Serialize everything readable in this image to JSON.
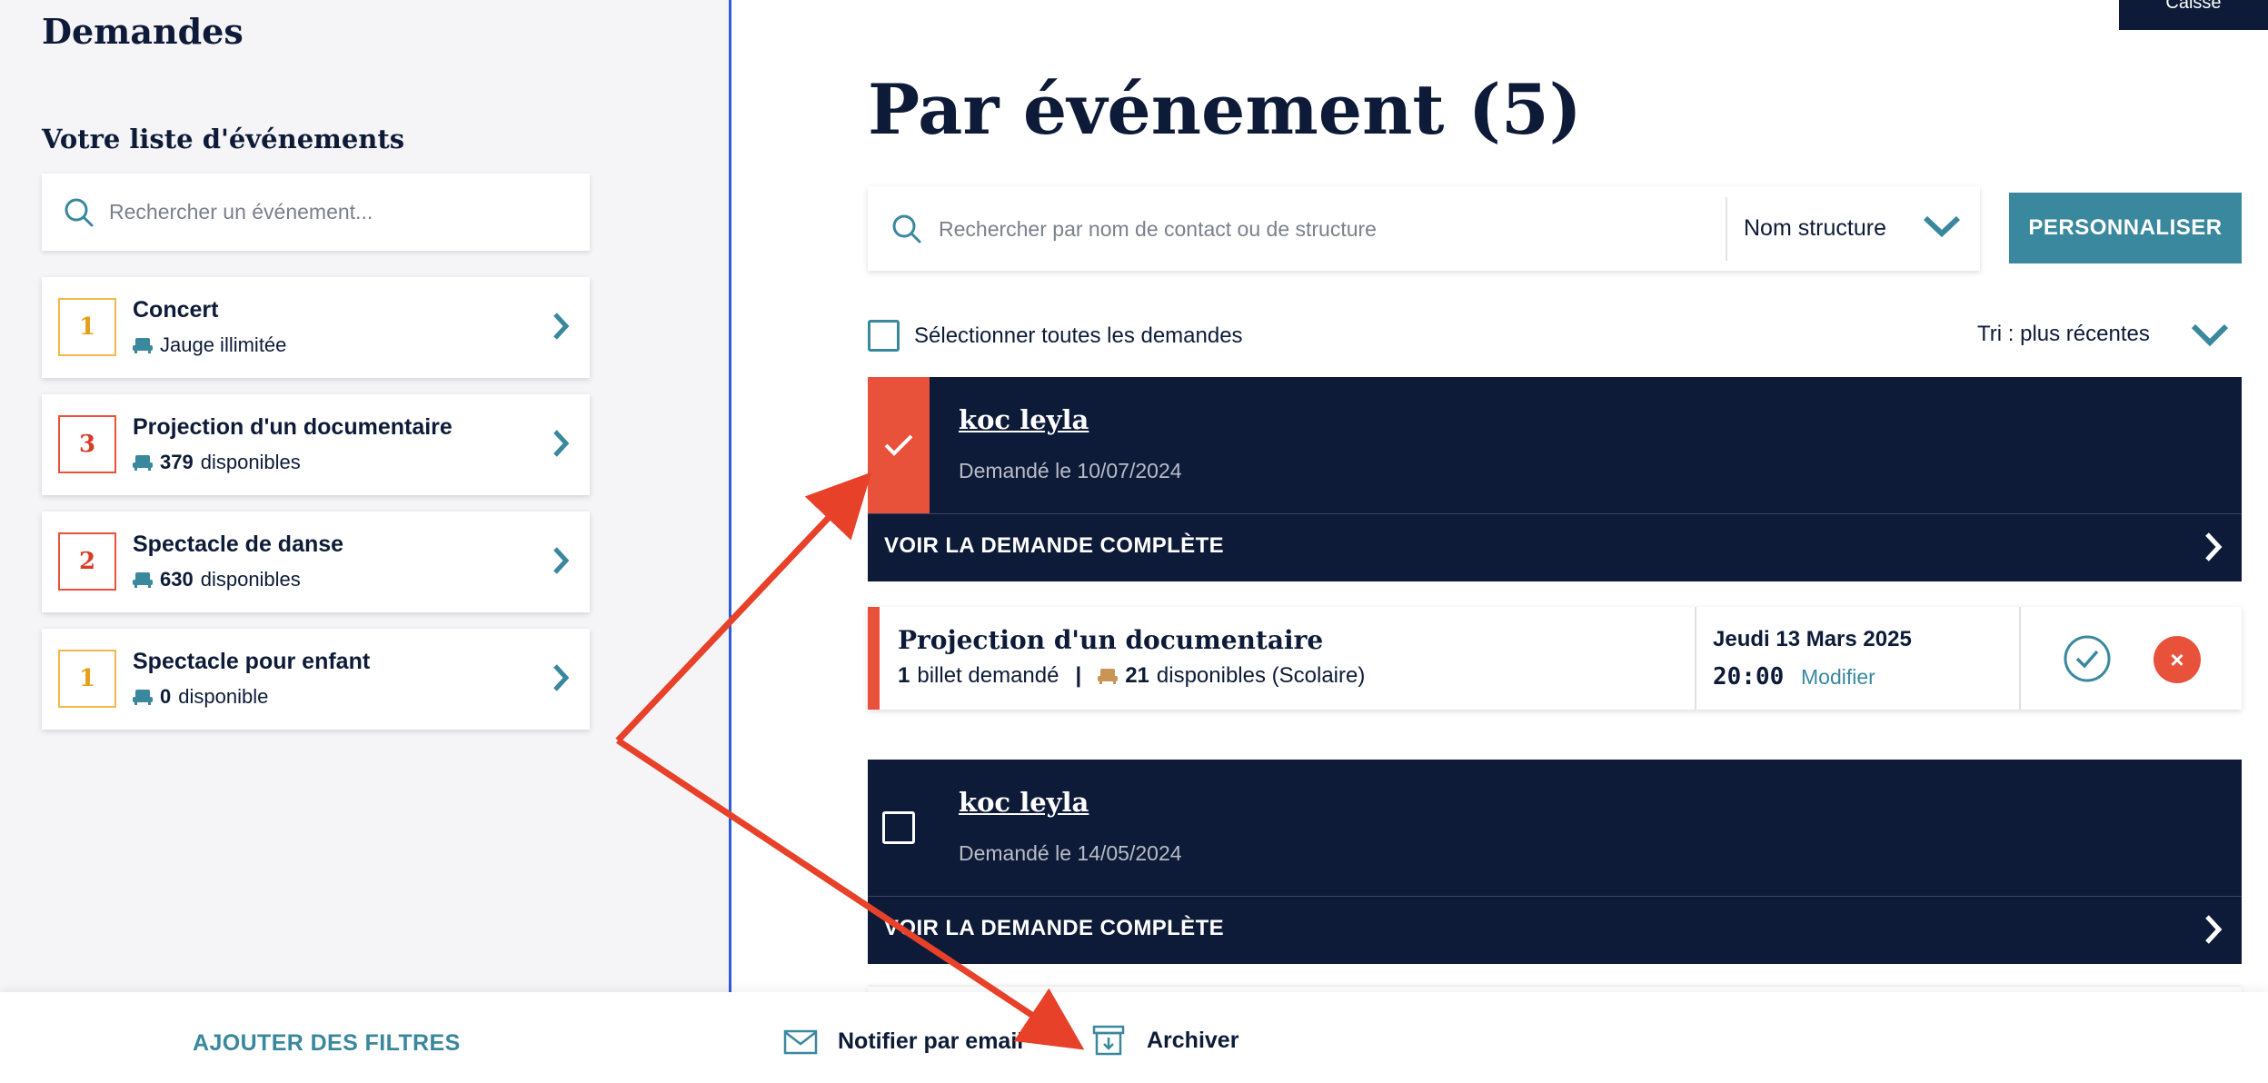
{
  "sidebar": {
    "title": "Demandes",
    "subtitle": "Votre liste d'événements",
    "search_placeholder": "Rechercher un événement...",
    "events": [
      {
        "count": "1",
        "name": "Concert",
        "qty": "",
        "status": "Jauge illimitée"
      },
      {
        "count": "3",
        "name": "Projection d'un documentaire",
        "qty": "379",
        "status": "disponibles"
      },
      {
        "count": "2",
        "name": "Spectacle de danse",
        "qty": "630",
        "status": "disponibles"
      },
      {
        "count": "1",
        "name": "Spectacle pour enfant",
        "qty": "0",
        "status": "disponible"
      }
    ]
  },
  "header": {
    "caisse_label": "Caisse"
  },
  "main": {
    "title": "Par événement (5)",
    "search_placeholder": "Rechercher par nom de contact ou de structure",
    "search_field": "Nom structure",
    "customize_label": "PERSONNALISER",
    "select_all_label": "Sélectionner toutes les demandes",
    "sort_label": "Tri : plus récentes",
    "requests": [
      {
        "contact": "koc leyla",
        "date": "Demandé le 10/07/2024",
        "view_label": "VOIR LA DEMANDE COMPLÈTE",
        "checked": true
      },
      {
        "contact": "koc leyla",
        "date": "Demandé le 14/05/2024",
        "view_label": "VOIR LA DEMANDE COMPLÈTE",
        "checked": false
      }
    ],
    "detail": {
      "event_name": "Projection d'un documentaire",
      "tickets_qty": "1",
      "tickets_label": "billet demandé",
      "separator": "|",
      "available_qty": "21",
      "available_label": "disponibles (Scolaire)",
      "day": "Jeudi 13 Mars 2025",
      "time": "20:00",
      "modify_label": "Modifier"
    }
  },
  "bottom_bar": {
    "add_filters_label": "AJOUTER DES FILTRES",
    "notify_label": "Notifier par email",
    "archive_label": "Archiver"
  },
  "colors": {
    "navy": "#0d1b38",
    "teal": "#3a889e",
    "red": "#e8513a",
    "orange": "#f2b84b",
    "divider_blue": "#2f5bd9"
  }
}
